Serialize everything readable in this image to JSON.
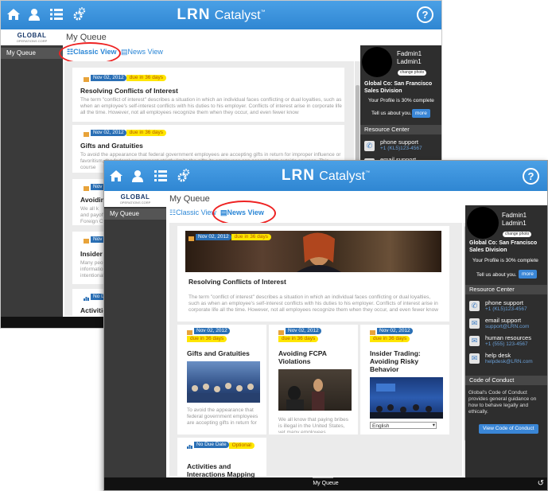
{
  "brand": {
    "name": "LRN",
    "product": "Catalyst",
    "tm": "™"
  },
  "logo": {
    "text": "GLOBAL",
    "sub": "OPERATIONS CORP"
  },
  "nav": {
    "my_queue": "My Queue"
  },
  "page": {
    "title": "My Queue"
  },
  "views": {
    "classic": "Classic View",
    "news": "News View"
  },
  "profile": {
    "first": "Fadmin1",
    "last": "Ladmin1",
    "change_photo": "change photo",
    "org": "Global Co: San Francisco Sales Division",
    "profile_pct": "Your Profile is 30% complete",
    "tell_us": "Tell us about you.",
    "more": "more"
  },
  "resource_center": {
    "heading": "Resource Center",
    "items": [
      {
        "label": "phone support",
        "detail": "+1 (KL5)123-4567"
      },
      {
        "label": "email support",
        "detail": "support@LRN.com"
      },
      {
        "label": "human resources",
        "detail": "+1 (555) 123-4567"
      },
      {
        "label": "help desk",
        "detail": "helpdesk@LRN.com"
      }
    ]
  },
  "code_of_conduct": {
    "heading": "Code of Conduct",
    "text": "Global's Code of Conduct provides general guidance on how to behave legally and ethically.",
    "button": "View Code of Conduct"
  },
  "classic_items": [
    {
      "date": "Nov 02, 2012",
      "due": "due in 36 days",
      "title": "Resolving Conflicts of Interest",
      "desc": "The term \"conflict of interest\" describes a situation in which an individual faces conflicting or dual loyalties, such as when an employee's self-interest conflicts with his duties to his employer. Conflicts of interest arise in corporate life all the time. However, not all employees recognize them when they occur, and even fewer know"
    },
    {
      "date": "Nov 02, 2012",
      "due": "due in 36 days",
      "title": "Gifts and Gratuities",
      "desc": "To avoid the appearance that federal government employees are accepting gifts in return for improper influence or favoritism, the federal government strictly limits the gifts its employees can accept from outside sources. This course"
    },
    {
      "date": "Nov 0",
      "title": "Avoidin",
      "desc": "We all k and payoffs Foreign C"
    },
    {
      "date": "Nov 0",
      "title": "Insider T",
      "desc": "Many peo information intentional"
    },
    {
      "date": "No Du",
      "title": "Activitie"
    }
  ],
  "news_items": [
    {
      "date": "Nov 02, 2012",
      "due": "due in 36 days",
      "title": "Resolving Conflicts of Interest",
      "desc": "The term \"conflict of interest\" describes a situation in which an individual faces conflicting or dual loyalties, such as when an employee's self-interest conflicts with his duties to his employer. Conflicts of interest arise in corporate life all the time. However, not all employees recognize them when they occur, and even fewer know"
    },
    {
      "date": "Nov 02, 2012",
      "due": "due in 36 days",
      "title": "Gifts and Gratuities",
      "desc": "To avoid the appearance that federal government employees are accepting gifts in return for"
    },
    {
      "date": "Nov 02, 2012",
      "due": "due in 36 days",
      "title": "Avoiding FCPA Violations",
      "desc": "We all know that paying bribes is illegal in the United States, yet many employees mistakenly"
    },
    {
      "date": "Nov 02, 2012",
      "due": "due in 36 days",
      "title": "Insider Trading: Avoiding Risky Behavior",
      "language": "English"
    },
    {
      "date": "No Due Date",
      "due": "Optional",
      "title": "Activities and Interactions Mapping"
    }
  ],
  "bottom": {
    "label": "My Queue"
  },
  "colors": {
    "topbar": "#3592de",
    "date_badge": "#2a6fb5",
    "due_badge": "#ffe600",
    "annotation": "#e22222"
  }
}
